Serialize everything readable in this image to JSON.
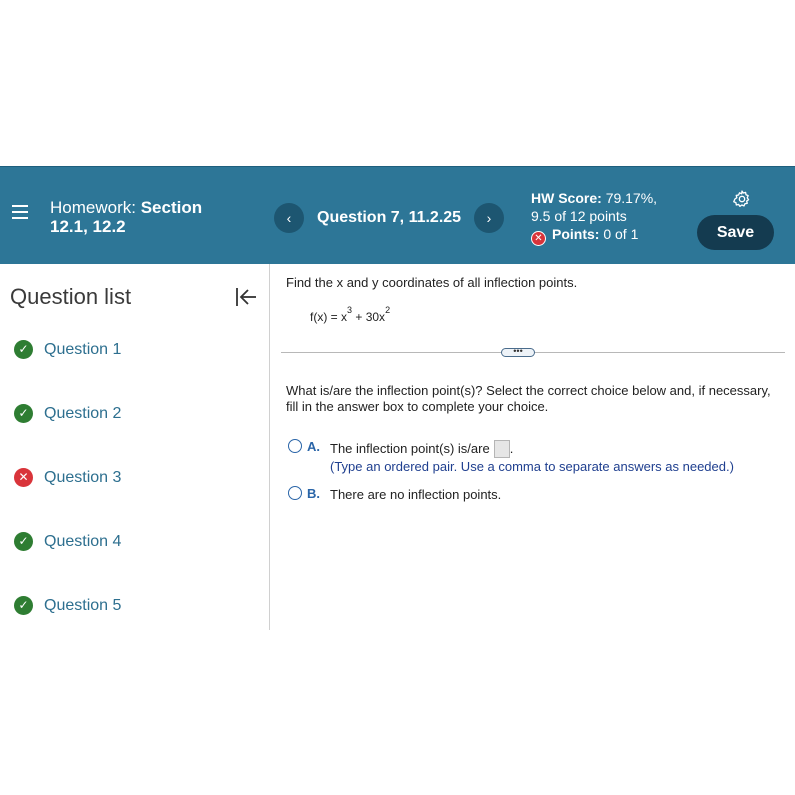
{
  "header": {
    "hw_label": "Homework:",
    "hw_section_line1": "Section",
    "hw_section_line2": "12.1, 12.2",
    "question_title": "Question 7, 11.2.25",
    "prev_glyph": "‹",
    "next_glyph": "›",
    "score_label": "HW Score:",
    "score_value": "79.17%,",
    "score_points": "9.5 of 12 points",
    "points_label": "Points:",
    "points_value": "0 of 1",
    "save_label": "Save",
    "colors": {
      "bar": "#2d7697",
      "save": "#143b50",
      "nav": "#1d5671"
    }
  },
  "sidebar": {
    "title": "Question list",
    "items": [
      {
        "label": "Question 1",
        "status": "correct",
        "icon": "check-icon"
      },
      {
        "label": "Question 2",
        "status": "correct",
        "icon": "check-icon"
      },
      {
        "label": "Question 3",
        "status": "incorrect",
        "icon": "x-icon"
      },
      {
        "label": "Question 4",
        "status": "correct",
        "icon": "check-icon"
      },
      {
        "label": "Question 5",
        "status": "correct",
        "icon": "check-icon"
      }
    ]
  },
  "question": {
    "prompt": "Find the x and y coordinates of all inflection points.",
    "function_prefix": "f(x) = x",
    "exp1": "3",
    "function_mid": " + 30x",
    "exp2": "2",
    "expand_dots": "•••",
    "instructions": "What is/are the inflection point(s)? Select the correct choice below and, if necessary, fill in the answer box to complete your choice.",
    "option_a_letter": "A.",
    "option_a_text": "The inflection point(s) is/are",
    "option_a_period": ".",
    "option_a_hint": "(Type an ordered pair. Use a comma to separate answers as needed.)",
    "option_b_letter": "B.",
    "option_b_text": "There are no inflection points."
  }
}
